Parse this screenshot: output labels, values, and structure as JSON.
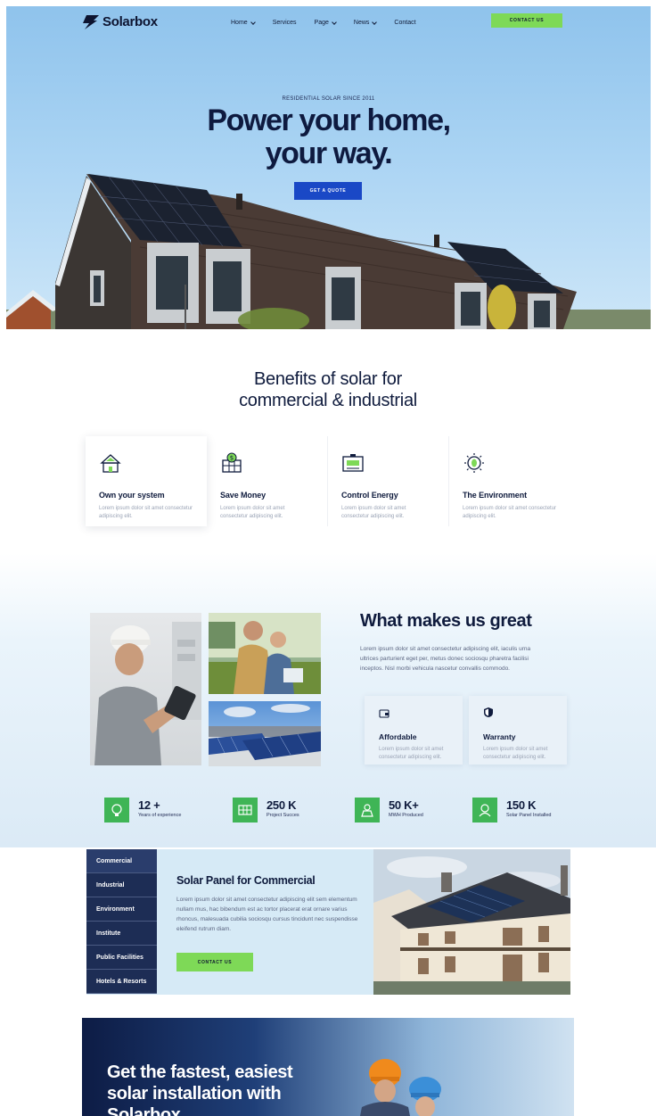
{
  "nav": {
    "brand": "Solarbox",
    "links": [
      {
        "label": "Home",
        "has_dropdown": true
      },
      {
        "label": "Services",
        "has_dropdown": false
      },
      {
        "label": "Page",
        "has_dropdown": true
      },
      {
        "label": "News",
        "has_dropdown": true
      },
      {
        "label": "Contact",
        "has_dropdown": false
      }
    ],
    "cta": "CONTACT US"
  },
  "hero": {
    "eyebrow": "RESIDENTIAL SOLAR SINCE 2011",
    "title_line1": "Power your home,",
    "title_line2": "your way.",
    "button": "GET A QUOTE"
  },
  "benefits": {
    "title_line1": "Benefits of solar for",
    "title_line2": "commercial & industrial",
    "items": [
      {
        "icon": "house-solar-icon",
        "title": "Own your system",
        "text": "Lorem ipsum dolor sit amet consectetur adipiscing elit."
      },
      {
        "icon": "solar-money-icon",
        "title": "Save Money",
        "text": "Lorem ipsum dolor sit amet consectetur adipiscing elit."
      },
      {
        "icon": "battery-meter-icon",
        "title": "Control Energy",
        "text": "Lorem ipsum dolor sit amet consectetur adipiscing elit."
      },
      {
        "icon": "eco-sun-icon",
        "title": "The Environment",
        "text": "Lorem ipsum dolor sit amet consectetur adipiscing elit."
      }
    ]
  },
  "great": {
    "title": "What makes us great",
    "text": "Lorem ipsum dolor sit amet consectetur adipiscing elit, iaculis urna ultrices parturient eget per, metus donec sociosqu pharetra facilisi inceptos. Nisl  morbi vehicula nascetur convallis commodo.",
    "features": [
      {
        "icon": "wallet-icon",
        "title": "Affordable",
        "text": "Lorem ipsum dolor sit amet consectetur adipiscing elit."
      },
      {
        "icon": "shield-icon",
        "title": "Warranty",
        "text": "Lorem ipsum dolor sit amet consectetur adipiscing elit."
      }
    ]
  },
  "stats": [
    {
      "icon": "bulb-icon",
      "number": "12 +",
      "label": "Years of experience"
    },
    {
      "icon": "panel-icon",
      "number": "250 K",
      "label": "Project Succes"
    },
    {
      "icon": "sun-panel-icon",
      "number": "50 K+",
      "label": "MWH Produced"
    },
    {
      "icon": "installer-icon",
      "number": "150 K",
      "label": "Solar Panel Installed"
    }
  ],
  "commercial": {
    "tabs": [
      "Commercial",
      "Industrial",
      "Environment",
      "Institute",
      "Public Facilities",
      "Hotels & Resorts"
    ],
    "active_tab": "Commercial",
    "title": "Solar Panel for Commercial",
    "text": "Lorem ipsum dolor sit amet consectetur adipiscing elit sem elementum nullam mus, hac bibendum est ac tortor placerat erat ornare varius rhoncus, malesuada cubilia sociosqu cursus tincidunt nec suspendisse eleifend rutrum diam.",
    "button": "CONTACT US"
  },
  "banner": {
    "title": "Get the fastest, easiest solar installation with Solarbox"
  },
  "colors": {
    "accent_green": "#7ed957",
    "stat_green": "#3fb556",
    "primary_blue": "#1a48c6",
    "navy": "#1d2d55"
  }
}
